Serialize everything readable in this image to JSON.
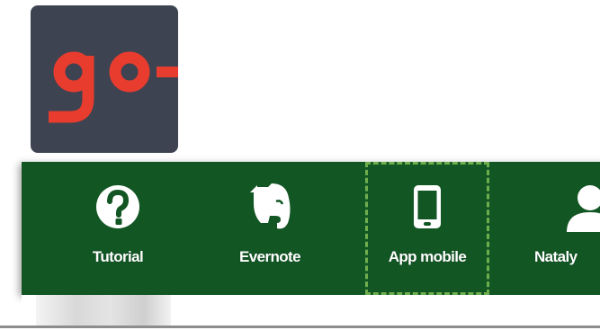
{
  "logo": {
    "icon": "go-logo",
    "background_color": "#3d4350",
    "accent_color": "#e83c2f"
  },
  "navbar": {
    "background_color": "#125624",
    "selection_color": "#6fae4d",
    "items": [
      {
        "label": "Tutorial",
        "icon": "question-circle-icon"
      },
      {
        "label": "Evernote",
        "icon": "evernote-elephant-icon"
      },
      {
        "label": "App mobile",
        "icon": "mobile-phone-icon",
        "selected": true
      },
      {
        "label": "Nataly",
        "icon": "user-icon"
      }
    ]
  }
}
